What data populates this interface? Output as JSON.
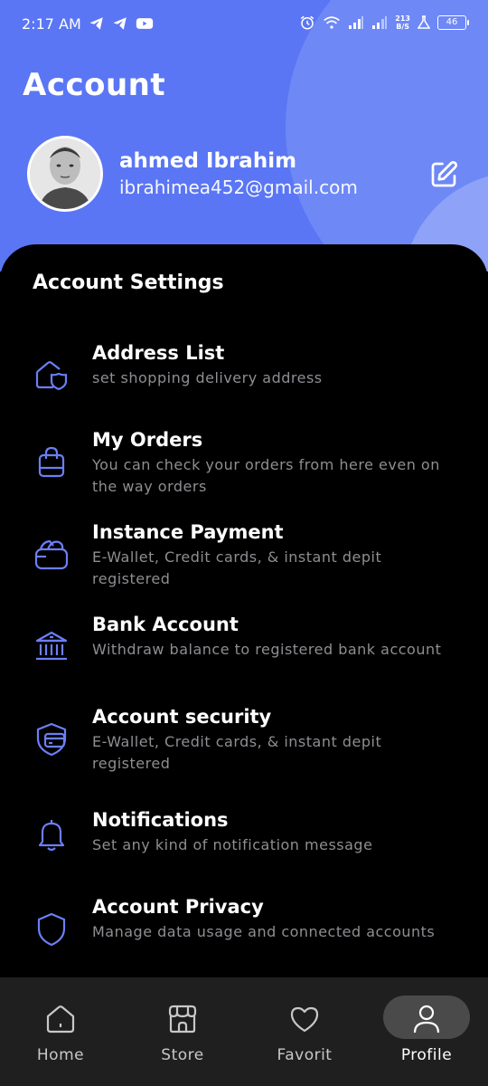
{
  "status": {
    "time": "2:17 AM",
    "netspeed_top": "213",
    "netspeed_bottom": "B/S",
    "battery": "46"
  },
  "header": {
    "title": "Account",
    "user_name": "ahmed Ibrahim",
    "user_email": "ibrahimea452@gmail.com"
  },
  "settings": {
    "section_title": "Account Settings",
    "items": [
      {
        "title": "Address List",
        "desc": "set shopping delivery address",
        "icon": "home-location-icon"
      },
      {
        "title": "My Orders",
        "desc": "You can check your orders from here even on the way orders",
        "icon": "bag-icon"
      },
      {
        "title": "Instance Payment",
        "desc": "E-Wallet, Credit cards, & instant depit registered",
        "icon": "wallet-icon"
      },
      {
        "title": "Bank Account",
        "desc": "Withdraw balance to registered bank account",
        "icon": "bank-icon"
      },
      {
        "title": "Account security",
        "desc": "E-Wallet, Credit cards, & instant depit registered",
        "icon": "security-card-icon"
      },
      {
        "title": "Notifications",
        "desc": "Set any kind of notification message",
        "icon": "bell-icon"
      },
      {
        "title": "Account Privacy",
        "desc": "Manage data usage and connected accounts",
        "icon": "shield-icon"
      }
    ]
  },
  "nav": {
    "items": [
      {
        "label": "Home",
        "icon": "home-icon"
      },
      {
        "label": "Store",
        "icon": "store-icon"
      },
      {
        "label": "Favorit",
        "icon": "heart-icon"
      },
      {
        "label": "Profile",
        "icon": "user-icon"
      }
    ],
    "active": "Profile"
  },
  "colors": {
    "header_bg": "#5a76f4",
    "accent_icon": "#6b7ff5",
    "content_bg": "#000000",
    "nav_bg": "#1f1f1f"
  }
}
